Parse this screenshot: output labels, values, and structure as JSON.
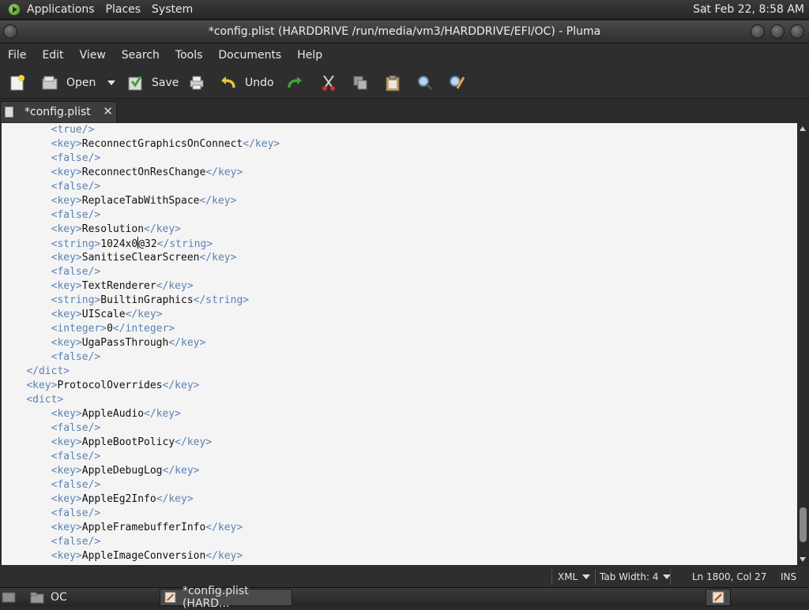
{
  "top_panel": {
    "menus": [
      "Applications",
      "Places",
      "System"
    ],
    "clock": "Sat Feb 22,  8:58 AM"
  },
  "window": {
    "title": "*config.plist (HARDDRIVE /run/media/vm3/HARDDRIVE/EFI/OC) - Pluma"
  },
  "menubar": [
    "File",
    "Edit",
    "View",
    "Search",
    "Tools",
    "Documents",
    "Help"
  ],
  "toolbar": {
    "open_label": "Open",
    "save_label": "Save",
    "undo_label": "Undo"
  },
  "tabs": [
    {
      "label": "*config.plist",
      "close": "✕"
    }
  ],
  "editor": {
    "lines": [
      {
        "indent": "        ",
        "open": "<true/>",
        "text": "",
        "close": ""
      },
      {
        "indent": "        ",
        "open": "<key>",
        "text": "ReconnectGraphicsOnConnect",
        "close": "</key>"
      },
      {
        "indent": "        ",
        "open": "<false/>",
        "text": "",
        "close": ""
      },
      {
        "indent": "        ",
        "open": "<key>",
        "text": "ReconnectOnResChange",
        "close": "</key>"
      },
      {
        "indent": "        ",
        "open": "<false/>",
        "text": "",
        "close": ""
      },
      {
        "indent": "        ",
        "open": "<key>",
        "text": "ReplaceTabWithSpace",
        "close": "</key>"
      },
      {
        "indent": "        ",
        "open": "<false/>",
        "text": "",
        "close": ""
      },
      {
        "indent": "        ",
        "open": "<key>",
        "text": "Resolution",
        "close": "</key>"
      },
      {
        "indent": "        ",
        "open": "<string>",
        "text": "1024x0",
        "text2": "@32",
        "close": "</string>",
        "cursor": true
      },
      {
        "indent": "        ",
        "open": "<key>",
        "text": "SanitiseClearScreen",
        "close": "</key>"
      },
      {
        "indent": "        ",
        "open": "<false/>",
        "text": "",
        "close": ""
      },
      {
        "indent": "        ",
        "open": "<key>",
        "text": "TextRenderer",
        "close": "</key>"
      },
      {
        "indent": "        ",
        "open": "<string>",
        "text": "BuiltinGraphics",
        "close": "</string>"
      },
      {
        "indent": "        ",
        "open": "<key>",
        "text": "UIScale",
        "close": "</key>"
      },
      {
        "indent": "        ",
        "open": "<integer>",
        "text": "0",
        "close": "</integer>"
      },
      {
        "indent": "        ",
        "open": "<key>",
        "text": "UgaPassThrough",
        "close": "</key>"
      },
      {
        "indent": "        ",
        "open": "<false/>",
        "text": "",
        "close": ""
      },
      {
        "indent": "    ",
        "open": "</dict>",
        "text": "",
        "close": ""
      },
      {
        "indent": "    ",
        "open": "<key>",
        "text": "ProtocolOverrides",
        "close": "</key>"
      },
      {
        "indent": "    ",
        "open": "<dict>",
        "text": "",
        "close": ""
      },
      {
        "indent": "        ",
        "open": "<key>",
        "text": "AppleAudio",
        "close": "</key>"
      },
      {
        "indent": "        ",
        "open": "<false/>",
        "text": "",
        "close": ""
      },
      {
        "indent": "        ",
        "open": "<key>",
        "text": "AppleBootPolicy",
        "close": "</key>"
      },
      {
        "indent": "        ",
        "open": "<false/>",
        "text": "",
        "close": ""
      },
      {
        "indent": "        ",
        "open": "<key>",
        "text": "AppleDebugLog",
        "close": "</key>"
      },
      {
        "indent": "        ",
        "open": "<false/>",
        "text": "",
        "close": ""
      },
      {
        "indent": "        ",
        "open": "<key>",
        "text": "AppleEg2Info",
        "close": "</key>"
      },
      {
        "indent": "        ",
        "open": "<false/>",
        "text": "",
        "close": ""
      },
      {
        "indent": "        ",
        "open": "<key>",
        "text": "AppleFramebufferInfo",
        "close": "</key>"
      },
      {
        "indent": "        ",
        "open": "<false/>",
        "text": "",
        "close": ""
      },
      {
        "indent": "        ",
        "open": "<key>",
        "text": "AppleImageConversion",
        "close": "</key>"
      }
    ]
  },
  "statusbar": {
    "language": "XML",
    "tab_width": "Tab Width:  4",
    "position": "Ln 1800, Col 27",
    "mode": "INS"
  },
  "taskbar": {
    "items": [
      {
        "label": "OC"
      },
      {
        "label": "*config.plist (HARD..."
      }
    ]
  },
  "colors": {
    "tag": "#5a82b4",
    "editor_bg": "#f4f4f4",
    "chrome": "#2e2e2e"
  }
}
